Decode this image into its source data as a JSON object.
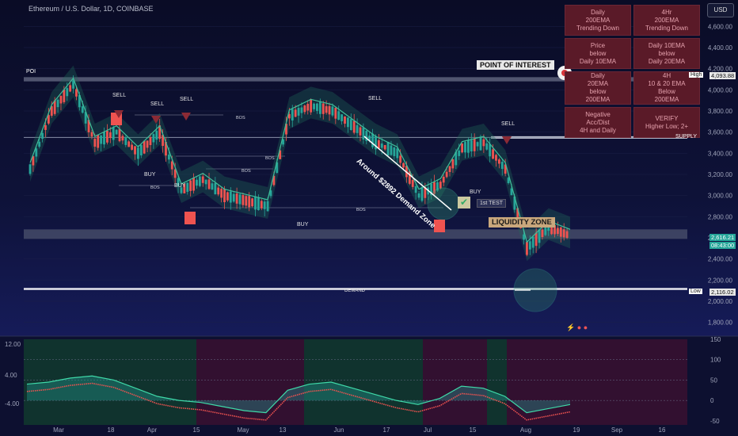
{
  "header": {
    "title": "Ethereum / U.S. Dollar, 1D, COINBASE",
    "currency_button": "USD"
  },
  "colors": {
    "background": "#0b0e2b",
    "bull": "#26a69a",
    "bear": "#ef5350",
    "cloud": "#1f6b5a",
    "signal_box": "#5a1a28",
    "supply_band": "#8a90a8",
    "liquidity_band": "#5a6078"
  },
  "signal_panel": [
    {
      "text": "Daily\n200EMA\nTrending Down"
    },
    {
      "text": "4Hr\n200EMA\nTrending Down"
    },
    {
      "text": "Price\nbelow\nDaily 10EMA"
    },
    {
      "text": "Daily 10EMA\nbelow\nDaily 20EMA"
    },
    {
      "text": "Daily\n20EMA\nbelow\n200EMA"
    },
    {
      "text": "4H\n10 & 20 EMA\nBelow\n200EMA"
    },
    {
      "text": "Negative\nAcc/Dist\n4H and Daily"
    },
    {
      "text": "VERIFY\nHigher Low; 2+"
    }
  ],
  "annotations": {
    "poi": "POINT OF INTEREST",
    "poi_small": "POI",
    "liquidity": "LIQUIDITY ZONE",
    "demand": "Around $2892 Demand Zone",
    "first_test": "1st TEST",
    "supply": "SUPPLY",
    "demand_line": "DEMAND",
    "sell_labels": [
      "SELL",
      "SELL",
      "SELL",
      "SELL",
      "SELL"
    ],
    "buy_labels": [
      "BUY",
      "BUY",
      "BUY",
      "BUY"
    ],
    "bos": "BOS"
  },
  "chart_data": [
    {
      "type": "line",
      "title": "Ethereum / U.S. Dollar, 1D, COINBASE",
      "xlabel": "",
      "ylabel": "",
      "ylim": [
        1700,
        4700
      ],
      "y_ticks": [
        "4,600.00",
        "4,400.00",
        "4,200.00",
        "4,000.00",
        "3,800.00",
        "3,600.00",
        "3,400.00",
        "3,200.00",
        "3,000.00",
        "2,800.00",
        "2,600.00",
        "2,400.00",
        "2,200.00",
        "2,000.00",
        "1,800.00"
      ],
      "x_ticks": [
        "Mar",
        "18",
        "Apr",
        "15",
        "May",
        "13",
        "Jun",
        "17",
        "Jul",
        "15",
        "Aug",
        "19",
        "Sep",
        "16"
      ],
      "price_labels": {
        "high_label": "High",
        "high": "4,093.88",
        "last": "2,616.21",
        "countdown": "08:43:00",
        "low_label": "Low",
        "low": "2,116.02"
      },
      "levels": {
        "poi_band": [
          4080,
          4120
        ],
        "supply": 3550,
        "liquidity_zone": [
          2590,
          2680
        ],
        "demand": 2116
      },
      "series": [
        {
          "x": [
            "Feb 27",
            "Mar 4",
            "Mar 11",
            "Mar 18",
            "Mar 25",
            "Apr 1",
            "Apr 8",
            "Apr 15",
            "Apr 22",
            "Apr 29",
            "May 6",
            "May 13",
            "May 20",
            "May 27",
            "Jun 3",
            "Jun 10",
            "Jun 17",
            "Jun 24",
            "Jul 1",
            "Jul 8",
            "Jul 15",
            "Jul 22",
            "Jul 29",
            "Aug 5",
            "Aug 12",
            "Aug 19"
          ],
          "values": [
            3250,
            3800,
            4050,
            3500,
            3600,
            3400,
            3600,
            3050,
            3150,
            3000,
            2950,
            2900,
            3750,
            3850,
            3800,
            3650,
            3500,
            3400,
            3000,
            3100,
            3450,
            3500,
            3250,
            2500,
            2700,
            2620
          ]
        }
      ]
    },
    {
      "type": "area",
      "title": "",
      "ylim": [
        -60,
        150
      ],
      "left_ticks": [
        "12.00",
        "4.00",
        "-4.00"
      ],
      "right_ticks": [
        "150",
        "100",
        "50",
        "0",
        "-50"
      ],
      "series": [
        {
          "values": [
            40,
            45,
            55,
            60,
            50,
            30,
            10,
            0,
            -5,
            -15,
            -25,
            -30,
            25,
            40,
            45,
            30,
            15,
            0,
            -10,
            5,
            35,
            30,
            10,
            -30,
            -20,
            -10
          ]
        }
      ]
    }
  ]
}
